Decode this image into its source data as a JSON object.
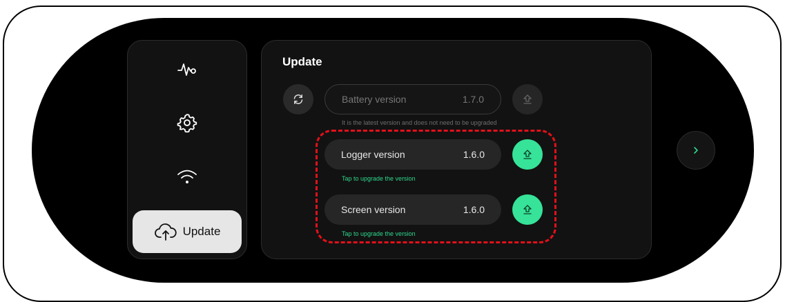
{
  "sidebar": {
    "items": [
      {
        "icon": "pulse-icon",
        "label": ""
      },
      {
        "icon": "gear-icon",
        "label": ""
      },
      {
        "icon": "wifi-icon",
        "label": ""
      },
      {
        "icon": "cloud-upload-icon",
        "label": "Update",
        "active": true
      }
    ]
  },
  "panel": {
    "title": "Update",
    "versions": [
      {
        "name": "Battery version",
        "value": "1.7.0",
        "hint": "It is the latest version and does not need to be upgraded",
        "upgradable": false
      },
      {
        "name": "Logger version",
        "value": "1.6.0",
        "hint": "Tap to upgrade the version",
        "upgradable": true
      },
      {
        "name": "Screen version",
        "value": "1.6.0",
        "hint": "Tap to upgrade the version",
        "upgradable": true
      }
    ]
  },
  "colors": {
    "accent_green": "#36e398",
    "highlight_red": "#e3101a",
    "background": "#000000"
  }
}
